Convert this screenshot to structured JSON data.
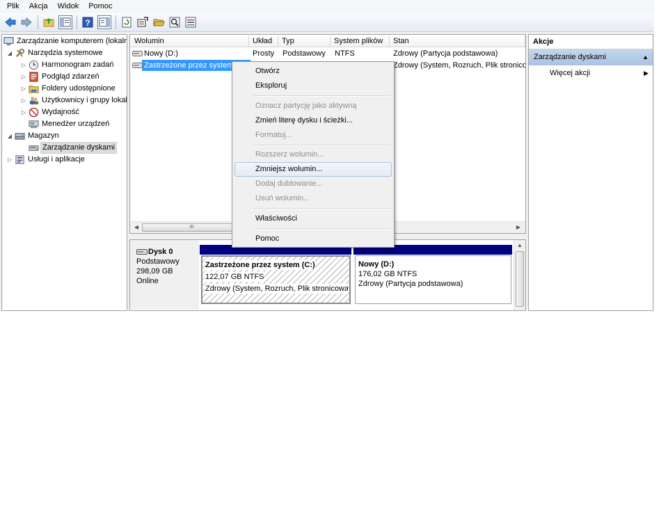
{
  "menu": [
    "Plik",
    "Akcja",
    "Widok",
    "Pomoc"
  ],
  "tree": {
    "root": "Zarządzanie komputerem (lokalne)",
    "system_tools": "Narzędzia systemowe",
    "task_scheduler": "Harmonogram zadań",
    "event_viewer": "Podgląd zdarzeń",
    "shared_folders": "Foldery udostępnione",
    "local_users": "Użytkownicy i grupy lokalne",
    "performance": "Wydajność",
    "device_manager": "Menedżer urządzeń",
    "storage": "Magazyn",
    "disk_management": "Zarządzanie dyskami",
    "services": "Usługi i aplikacje"
  },
  "columns": {
    "volume": "Wolumin",
    "layout": "Układ",
    "type": "Typ",
    "fs": "System plików",
    "status": "Stan"
  },
  "volumes": [
    {
      "name": "Nowy (D:)",
      "layout": "Prosty",
      "type": "Podstawowy",
      "fs": "NTFS",
      "status": "Zdrowy (Partycja podstawowa)"
    },
    {
      "name": "Zastrzeżone przez system (C:)",
      "status": "Zdrowy (System, Rozruch, Plik stronicowania, Aktywny)"
    }
  ],
  "scroll_thumb_label": "III",
  "disk": {
    "name": "Dysk 0",
    "type": "Podstawowy",
    "size": "298,09 GB",
    "state": "Online"
  },
  "partitions": [
    {
      "name": "Zastrzeżone przez system  (C:)",
      "size": "122,07 GB NTFS",
      "status": "Zdrowy (System, Rozruch, Plik stronicowania)"
    },
    {
      "name": "Nowy  (D:)",
      "size": "176,02 GB NTFS",
      "status": "Zdrowy (Partycja podstawowa)"
    }
  ],
  "actions": {
    "title": "Akcje",
    "group": "Zarządzanie dyskami",
    "more": "Więcej akcji"
  },
  "context_menu": {
    "open": "Otwórz",
    "explore": "Eksploruj",
    "mark_active": "Oznacz partycję jako aktywną",
    "change_letter": "Zmień literę dysku i ścieżki...",
    "format": "Formatuj...",
    "extend": "Rozszerz wolumin...",
    "shrink": "Zmniejsz wolumin...",
    "add_mirror": "Dodaj dublowanie...",
    "delete": "Usuń wolumin...",
    "properties": "Właściwości",
    "help": "Pomoc"
  },
  "colors": {
    "selection": "#3399ff",
    "partition_bar": "#000080",
    "actions_group": "#b6cde8"
  }
}
